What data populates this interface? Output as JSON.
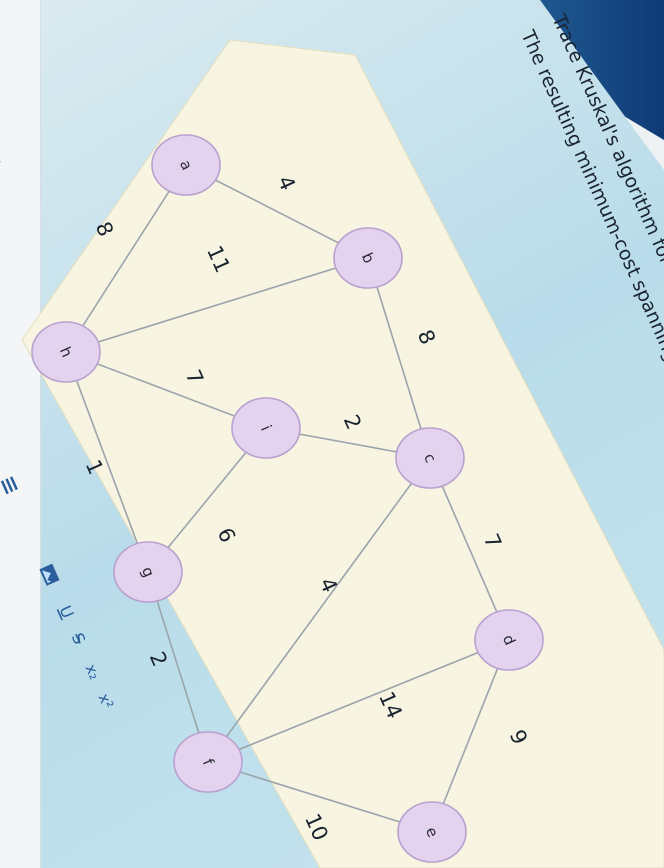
{
  "sidebar": {
    "label": "ion"
  },
  "question": {
    "line1": "Trace Kruskal's algorithm for the following graph",
    "line2": "The resulting minimum-cost spanning tree is:"
  },
  "graph": {
    "nodes": [
      "a",
      "b",
      "c",
      "d",
      "e",
      "f",
      "g",
      "h",
      "i"
    ],
    "edges": [
      {
        "from": "a",
        "to": "b",
        "weight": "4"
      },
      {
        "from": "a",
        "to": "h",
        "weight": "8"
      },
      {
        "from": "b",
        "to": "h",
        "weight": "11"
      },
      {
        "from": "b",
        "to": "c",
        "weight": "8"
      },
      {
        "from": "c",
        "to": "i",
        "weight": "2"
      },
      {
        "from": "c",
        "to": "d",
        "weight": "7"
      },
      {
        "from": "c",
        "to": "f",
        "weight": "4"
      },
      {
        "from": "h",
        "to": "i",
        "weight": "7"
      },
      {
        "from": "h",
        "to": "g",
        "weight": "1"
      },
      {
        "from": "i",
        "to": "g",
        "weight": "6"
      },
      {
        "from": "g",
        "to": "f",
        "weight": "2"
      },
      {
        "from": "d",
        "to": "f",
        "weight": "14"
      },
      {
        "from": "d",
        "to": "e",
        "weight": "9"
      },
      {
        "from": "f",
        "to": "e",
        "weight": "10"
      }
    ]
  },
  "toolbar": {
    "list_icon": "list-icon",
    "image_icon": "image-icon",
    "underline": "U",
    "strike": "S",
    "subscript": "x₂",
    "superscript": "x²"
  },
  "colors": {
    "node_fill": "#e4d3ef",
    "node_stroke": "#b9a1cf",
    "edge": "#9aa4ab",
    "card": "#f7f4e1"
  }
}
